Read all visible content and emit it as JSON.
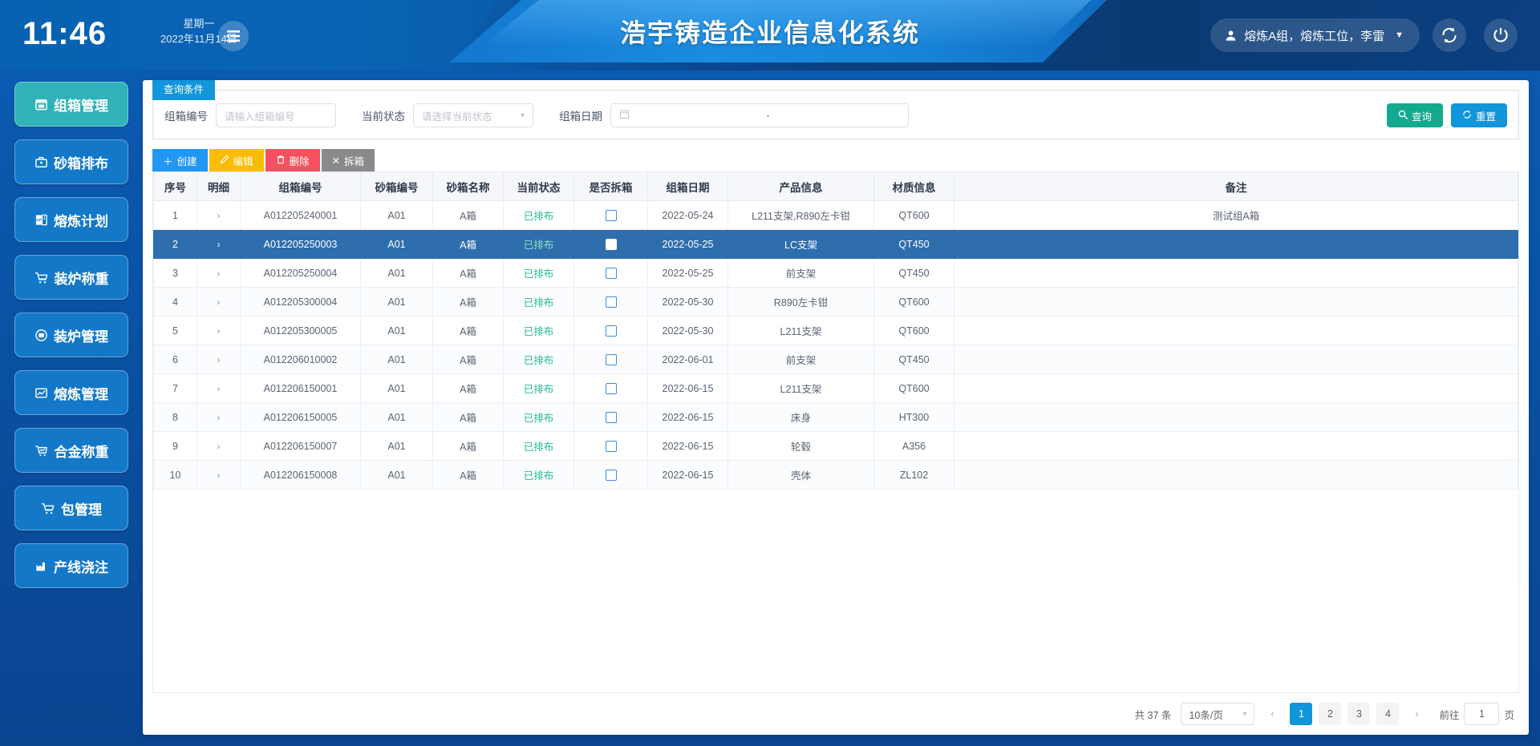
{
  "header": {
    "clock": "11:46",
    "weekday": "星期一",
    "date": "2022年11月14日",
    "title": "浩宇铸造企业信息化系统",
    "user": "熔炼A组，熔炼工位，李雷",
    "caret": "▼",
    "menu_icon": "hamburger-icon",
    "refresh_icon": "refresh-icon",
    "power_icon": "power-icon"
  },
  "sidebar": {
    "items": [
      {
        "label": "组箱管理",
        "icon": "archive-box-icon",
        "active": true
      },
      {
        "label": "砂箱排布",
        "icon": "briefcase-icon",
        "active": false
      },
      {
        "label": "熔炼计划",
        "icon": "zip-file-icon",
        "active": false
      },
      {
        "label": "装炉称重",
        "icon": "cart-icon",
        "active": false
      },
      {
        "label": "装炉管理",
        "icon": "monitor-icon",
        "active": false
      },
      {
        "label": "熔炼管理",
        "icon": "chart-box-icon",
        "active": false
      },
      {
        "label": "合金称重",
        "icon": "cart-chart-icon",
        "active": false
      },
      {
        "label": "包管理",
        "icon": "cart-icon",
        "active": false
      },
      {
        "label": "产线浇注",
        "icon": "factory-icon",
        "active": false
      }
    ]
  },
  "query": {
    "tab_label": "查询条件",
    "code_label": "组箱编号",
    "code_placeholder": "请输入组箱编号",
    "code_value": "",
    "status_label": "当前状态",
    "status_placeholder": "请选择当前状态",
    "status_value": "",
    "date_label": "组箱日期",
    "date_separator": "-",
    "date_value": "",
    "search_button": "查询",
    "search_icon": "search-icon",
    "reset_button": "重置",
    "reset_icon": "refresh-icon"
  },
  "actions": [
    {
      "label": "创建",
      "icon": "plus-icon",
      "style": "act-create"
    },
    {
      "label": "编辑",
      "icon": "pencil-icon",
      "style": "act-edit"
    },
    {
      "label": "删除",
      "icon": "trash-icon",
      "style": "act-delete"
    },
    {
      "label": "拆箱",
      "icon": "close-icon",
      "style": "act-unbox"
    }
  ],
  "table": {
    "columns": [
      "序号",
      "明细",
      "组箱编号",
      "砂箱编号",
      "砂箱名称",
      "当前状态",
      "是否拆箱",
      "组箱日期",
      "产品信息",
      "材质信息",
      "备注"
    ],
    "rows": [
      {
        "no": "1",
        "code": "A012205240001",
        "box_no": "A01",
        "box_name": "A箱",
        "status": "已排布",
        "unbox": false,
        "date": "2022-05-24",
        "product": "L211支架,R890左卡钳",
        "material": "QT600",
        "remark": "测试组A箱",
        "selected": false
      },
      {
        "no": "2",
        "code": "A012205250003",
        "box_no": "A01",
        "box_name": "A箱",
        "status": "已排布",
        "unbox": true,
        "date": "2022-05-25",
        "product": "LC支架",
        "material": "QT450",
        "remark": "",
        "selected": true
      },
      {
        "no": "3",
        "code": "A012205250004",
        "box_no": "A01",
        "box_name": "A箱",
        "status": "已排布",
        "unbox": false,
        "date": "2022-05-25",
        "product": "前支架",
        "material": "QT450",
        "remark": "",
        "selected": false
      },
      {
        "no": "4",
        "code": "A012205300004",
        "box_no": "A01",
        "box_name": "A箱",
        "status": "已排布",
        "unbox": false,
        "date": "2022-05-30",
        "product": "R890左卡钳",
        "material": "QT600",
        "remark": "",
        "selected": false
      },
      {
        "no": "5",
        "code": "A012205300005",
        "box_no": "A01",
        "box_name": "A箱",
        "status": "已排布",
        "unbox": false,
        "date": "2022-05-30",
        "product": "L211支架",
        "material": "QT600",
        "remark": "",
        "selected": false
      },
      {
        "no": "6",
        "code": "A012206010002",
        "box_no": "A01",
        "box_name": "A箱",
        "status": "已排布",
        "unbox": false,
        "date": "2022-06-01",
        "product": "前支架",
        "material": "QT450",
        "remark": "",
        "selected": false
      },
      {
        "no": "7",
        "code": "A012206150001",
        "box_no": "A01",
        "box_name": "A箱",
        "status": "已排布",
        "unbox": false,
        "date": "2022-06-15",
        "product": "L211支架",
        "material": "QT600",
        "remark": "",
        "selected": false
      },
      {
        "no": "8",
        "code": "A012206150005",
        "box_no": "A01",
        "box_name": "A箱",
        "status": "已排布",
        "unbox": false,
        "date": "2022-06-15",
        "product": "床身",
        "material": "HT300",
        "remark": "",
        "selected": false
      },
      {
        "no": "9",
        "code": "A012206150007",
        "box_no": "A01",
        "box_name": "A箱",
        "status": "已排布",
        "unbox": false,
        "date": "2022-06-15",
        "product": "轮毂",
        "material": "A356",
        "remark": "",
        "selected": false
      },
      {
        "no": "10",
        "code": "A012206150008",
        "box_no": "A01",
        "box_name": "A箱",
        "status": "已排布",
        "unbox": false,
        "date": "2022-06-15",
        "product": "壳体",
        "material": "ZL102",
        "remark": "",
        "selected": false
      }
    ]
  },
  "pagination": {
    "total_text": "共 37 条",
    "page_size": "10条/页",
    "prev": "‹",
    "next": "›",
    "pages": [
      "1",
      "2",
      "3",
      "4"
    ],
    "current_page": "1",
    "jump_label": "前往",
    "jump_value": "1",
    "jump_unit": "页"
  },
  "colors": {
    "brand_blue": "#1296db",
    "active_teal": "#2fb3b8",
    "sidebar_blue": "#1378c8",
    "selected_row": "#2e6ead",
    "status_green": "#28b998",
    "search_green": "#13a98f",
    "edit_yellow": "#fbbc05",
    "delete_red": "#f5515f"
  }
}
